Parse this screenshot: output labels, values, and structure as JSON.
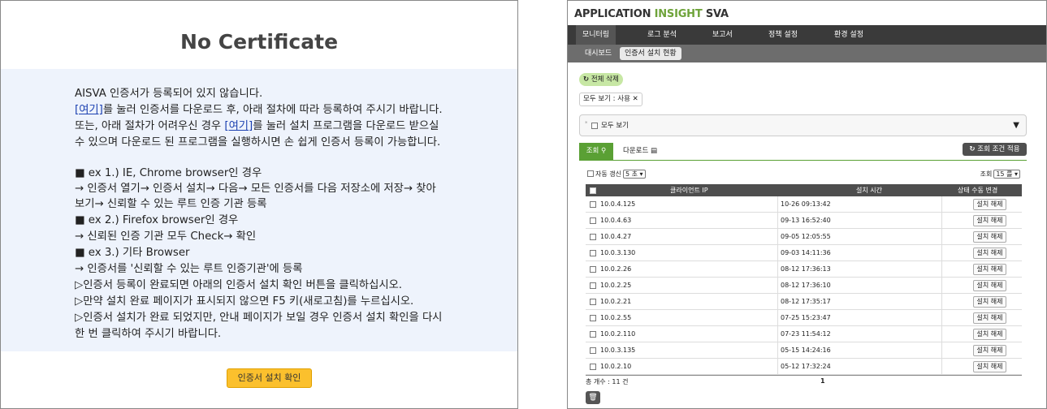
{
  "left": {
    "title": "No Certificate",
    "lines": [
      {
        "pre": "AISVA 인증서가 등록되어 있지 않습니다.",
        "link": "",
        "post": ""
      },
      {
        "pre": "",
        "link": "[여기]",
        "post": "를 눌러 인증서를 다운로드 후, 아래 절차에 따라 등록하여 주시기 바랍니다."
      },
      {
        "pre": "또는, 아래 절차가 어려우신 경우 ",
        "link": "[여기]",
        "post": "를 눌러 설치 프로그램을 다운로드 받으실"
      },
      {
        "pre": "수 있으며 다운로드 된 프로그램을 실행하시면 손 쉽게 인증서 등록이 가능합니다.",
        "link": "",
        "post": ""
      },
      {
        "pre": "■ ex 1.) IE, Chrome browser인 경우",
        "link": "",
        "post": ""
      },
      {
        "pre": "→ 인증서 열기→ 인증서 설치→ 다음→ 모든 인증서를 다음 저장소에 저장→ 찾아",
        "link": "",
        "post": ""
      },
      {
        "pre": "보기→ 신뢰할 수 있는 루트 인증 기관 등록",
        "link": "",
        "post": ""
      },
      {
        "pre": "■ ex 2.) Firefox browser인 경우",
        "link": "",
        "post": ""
      },
      {
        "pre": "→ 신뢰된 인증 기관 모두 Check→ 확인",
        "link": "",
        "post": ""
      },
      {
        "pre": "■ ex 3.) 기타 Browser",
        "link": "",
        "post": ""
      },
      {
        "pre": "→ 인증서를 '신뢰할 수 있는 루트 인증기관'에 등록",
        "link": "",
        "post": ""
      },
      {
        "pre": "▷인증서 등록이 완료되면 아래의 인증서 설치 확인 버튼을 클릭하십시오.",
        "link": "",
        "post": ""
      },
      {
        "pre": "▷만약 설치 완료 페이지가 표시되지 않으면 F5 키(새로고침)를 누르십시오.",
        "link": "",
        "post": ""
      },
      {
        "pre": "▷인증서 설치가 완료 되었지만, 안내 페이지가 보일 경우 인증서 설치 확인을 다시",
        "link": "",
        "post": ""
      },
      {
        "pre": "한 번 클릭하여 주시기 바랍니다.",
        "link": "",
        "post": ""
      }
    ],
    "confirm_button": "인증서 설치 확인"
  },
  "right": {
    "app_title_prefix": "APPLICATION ",
    "app_title_accent": "INSIGHT",
    "app_title_suffix": " SVA",
    "menu": [
      "모니터링",
      "로그 분석",
      "보고서",
      "정책 설정",
      "환경 설정"
    ],
    "submenu": [
      "대시보드",
      "인증서 설치 현황"
    ],
    "delete_all": "전체 삭제",
    "filter_tag": "모두 보기 : 사용",
    "filter_box_label": "모두 보기",
    "tab_query": "조회",
    "tab_download": "다운로드",
    "apply_button": "조회 조건 적용",
    "auto_refresh_label": "자동 갱신",
    "auto_refresh_value": "5 초",
    "page_size_label": "조회",
    "page_size_value": "15 를",
    "columns": [
      "클라이언트 IP",
      "설치 시간",
      "상태 수동 변경"
    ],
    "rows": [
      {
        "ip": "10.0.4.125",
        "time": "10-26 09:13:42",
        "action": "설치 해제"
      },
      {
        "ip": "10.0.4.63",
        "time": "09-13 16:52:40",
        "action": "설치 해제"
      },
      {
        "ip": "10.0.4.27",
        "time": "09-05 12:05:55",
        "action": "설치 해제"
      },
      {
        "ip": "10.0.3.130",
        "time": "09-03 14:11:36",
        "action": "설치 해제"
      },
      {
        "ip": "10.0.2.26",
        "time": "08-12 17:36:13",
        "action": "설치 해제"
      },
      {
        "ip": "10.0.2.25",
        "time": "08-12 17:36:10",
        "action": "설치 해제"
      },
      {
        "ip": "10.0.2.21",
        "time": "08-12 17:35:17",
        "action": "설치 해제"
      },
      {
        "ip": "10.0.2.55",
        "time": "07-25 15:23:47",
        "action": "설치 해제"
      },
      {
        "ip": "10.0.2.110",
        "time": "07-23 11:54:12",
        "action": "설치 해제"
      },
      {
        "ip": "10.0.3.135",
        "time": "05-15 14:24:16",
        "action": "설치 해제"
      },
      {
        "ip": "10.0.2.10",
        "time": "05-12 17:32:24",
        "action": "설치 해제"
      }
    ],
    "total_count": "총 개수 : 11 건",
    "page_number": "1",
    "icons": {
      "refresh": "refresh-icon",
      "search": "search-icon",
      "download": "file-icon",
      "trash": "trash-icon",
      "close": "close-icon",
      "caret": "caret-down-icon"
    }
  }
}
